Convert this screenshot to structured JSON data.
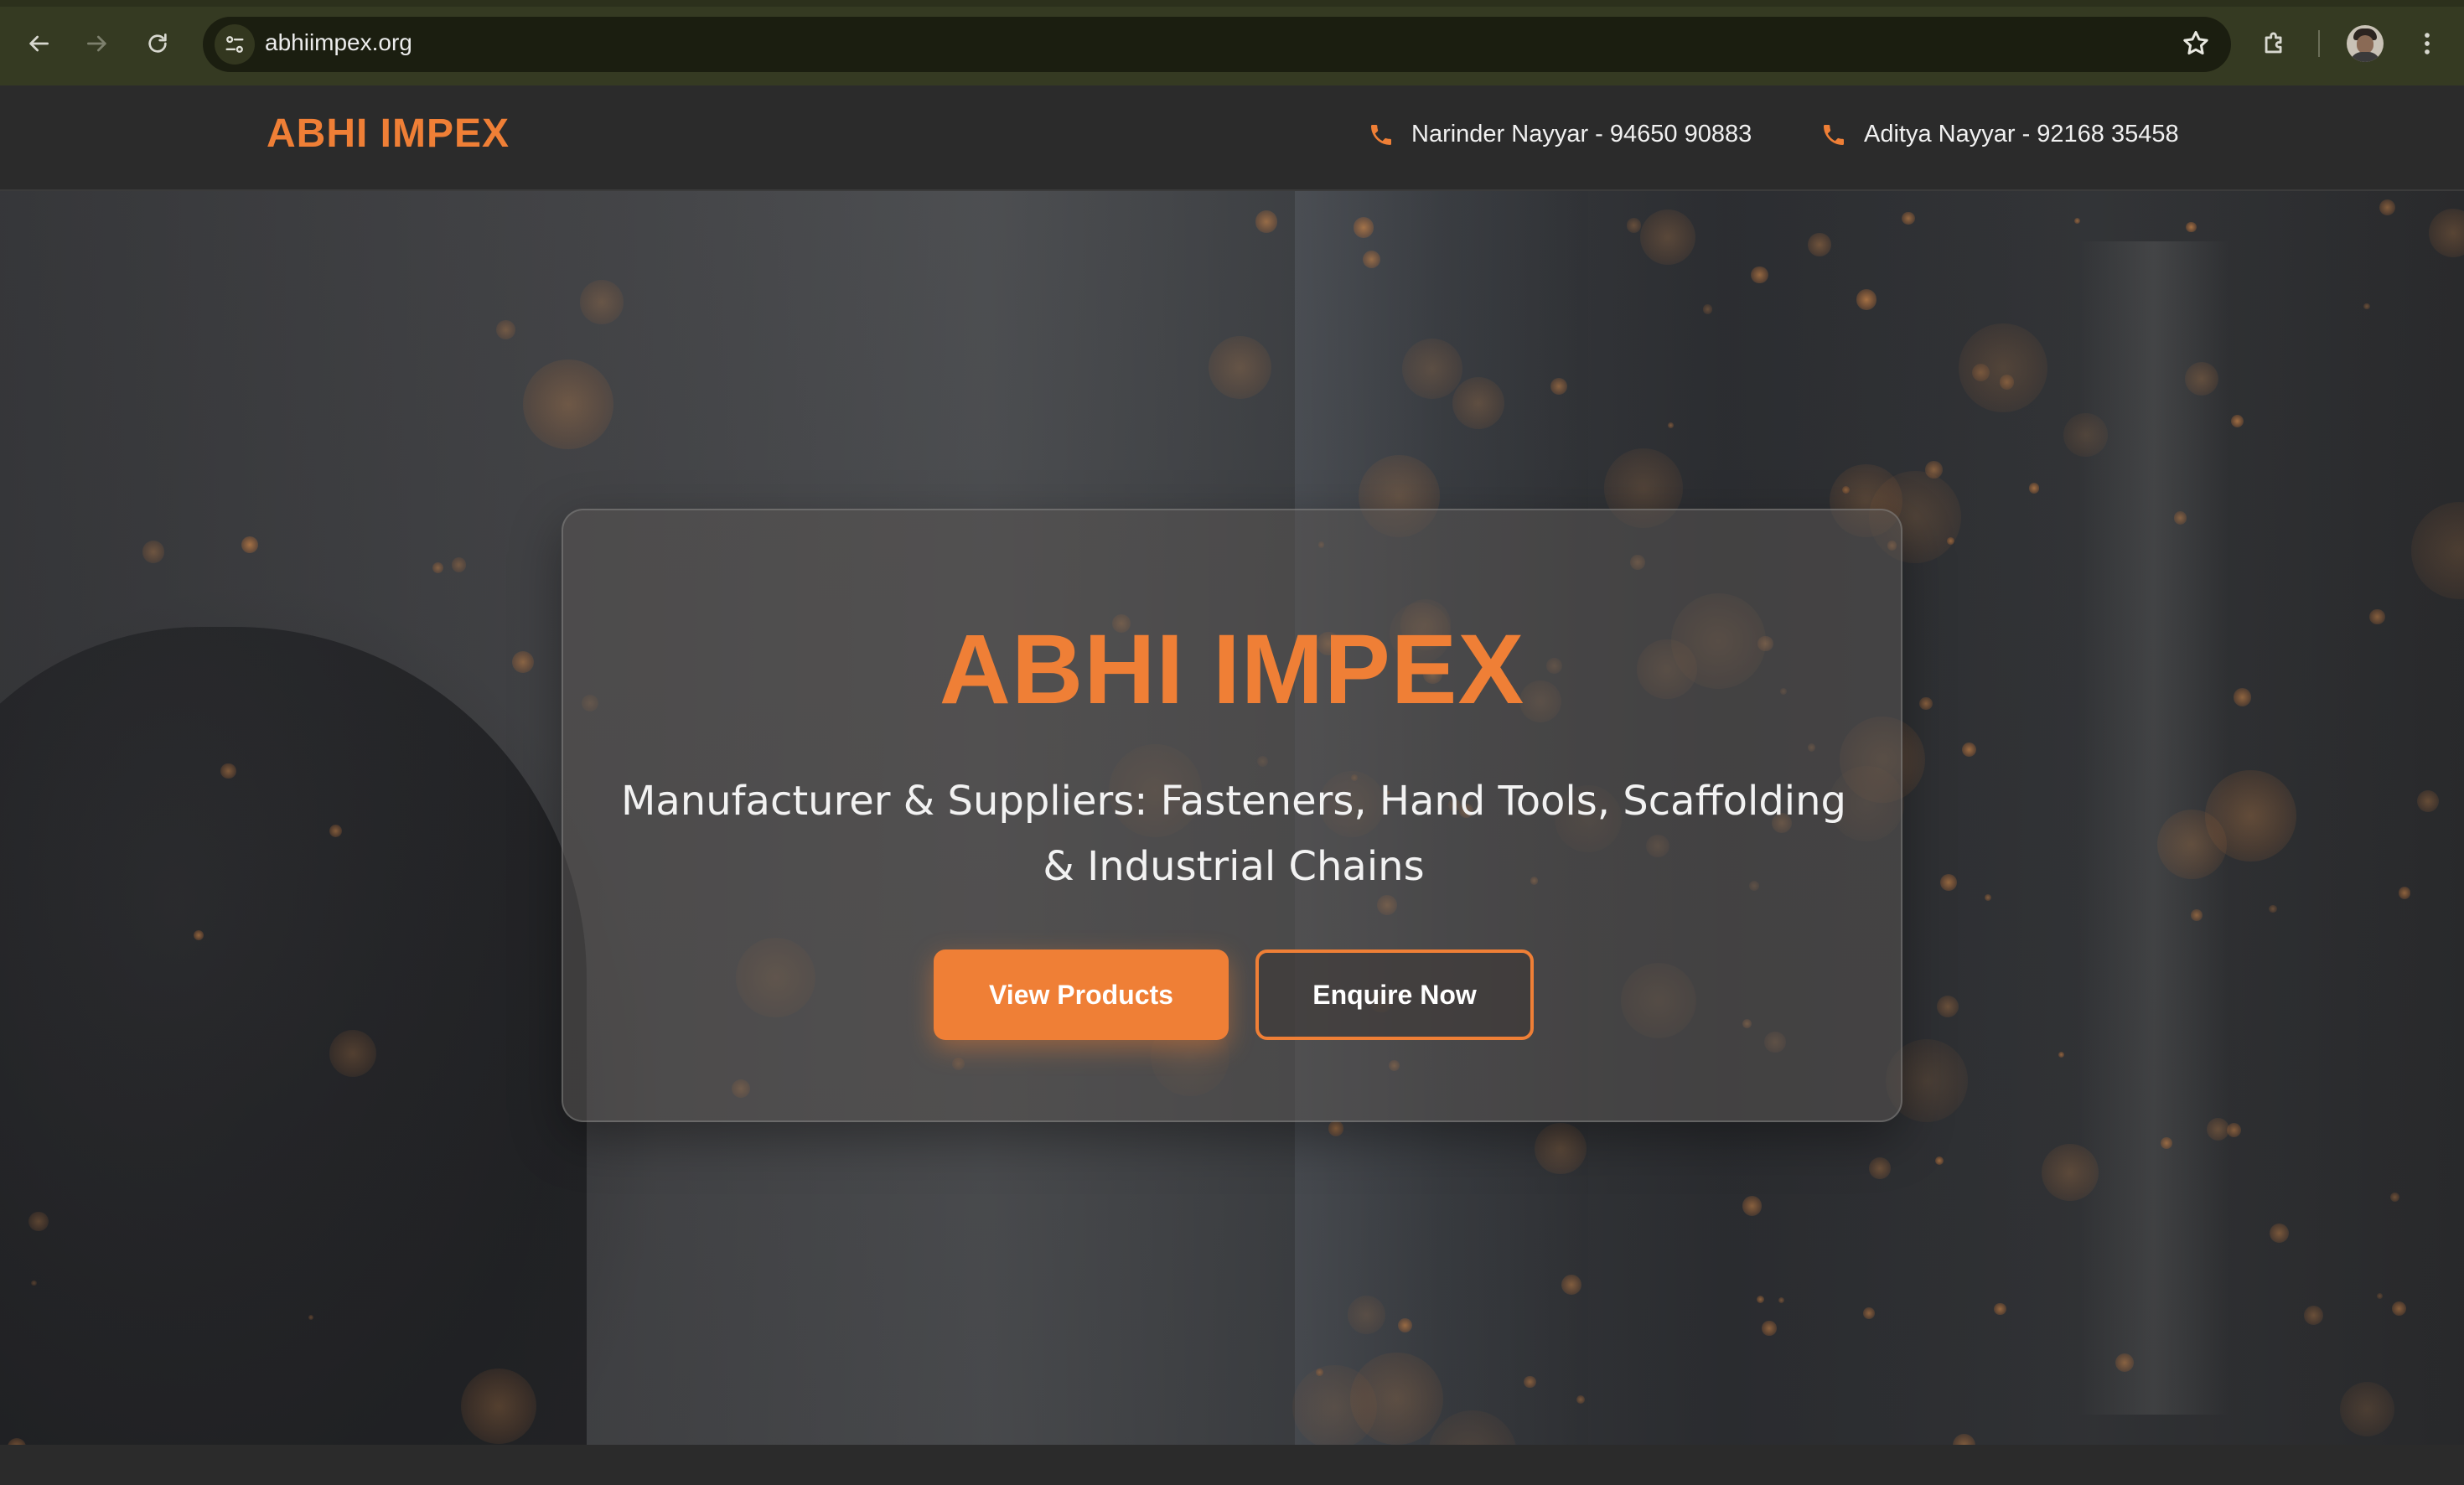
{
  "browser": {
    "url": "abhiimpex.org",
    "icons": [
      "back-arrow-icon",
      "forward-arrow-icon",
      "reload-icon",
      "site-info-icon",
      "bookmark-star-icon",
      "extensions-puzzle-icon",
      "profile-avatar",
      "more-vertical-icon"
    ]
  },
  "header": {
    "brand": "ABHI IMPEX",
    "contacts": [
      {
        "icon": "phone-icon",
        "text": "Narinder Nayyar - 94650 90883"
      },
      {
        "icon": "phone-icon",
        "text": "Aditya Nayyar - 92168 35458"
      }
    ]
  },
  "hero": {
    "title": "ABHI IMPEX",
    "subtitle_line1": "Manufacturer & Suppliers: Fasteners, Hand Tools, Scaffolding",
    "subtitle_line2": "& Industrial Chains",
    "primary_button": "View Products",
    "secondary_button": "Enquire Now"
  },
  "colors": {
    "accent": "#ef7f36",
    "header_bg": "#2b2b2b",
    "browser_bar": "#353a22",
    "omnibox": "#1b1e10"
  }
}
